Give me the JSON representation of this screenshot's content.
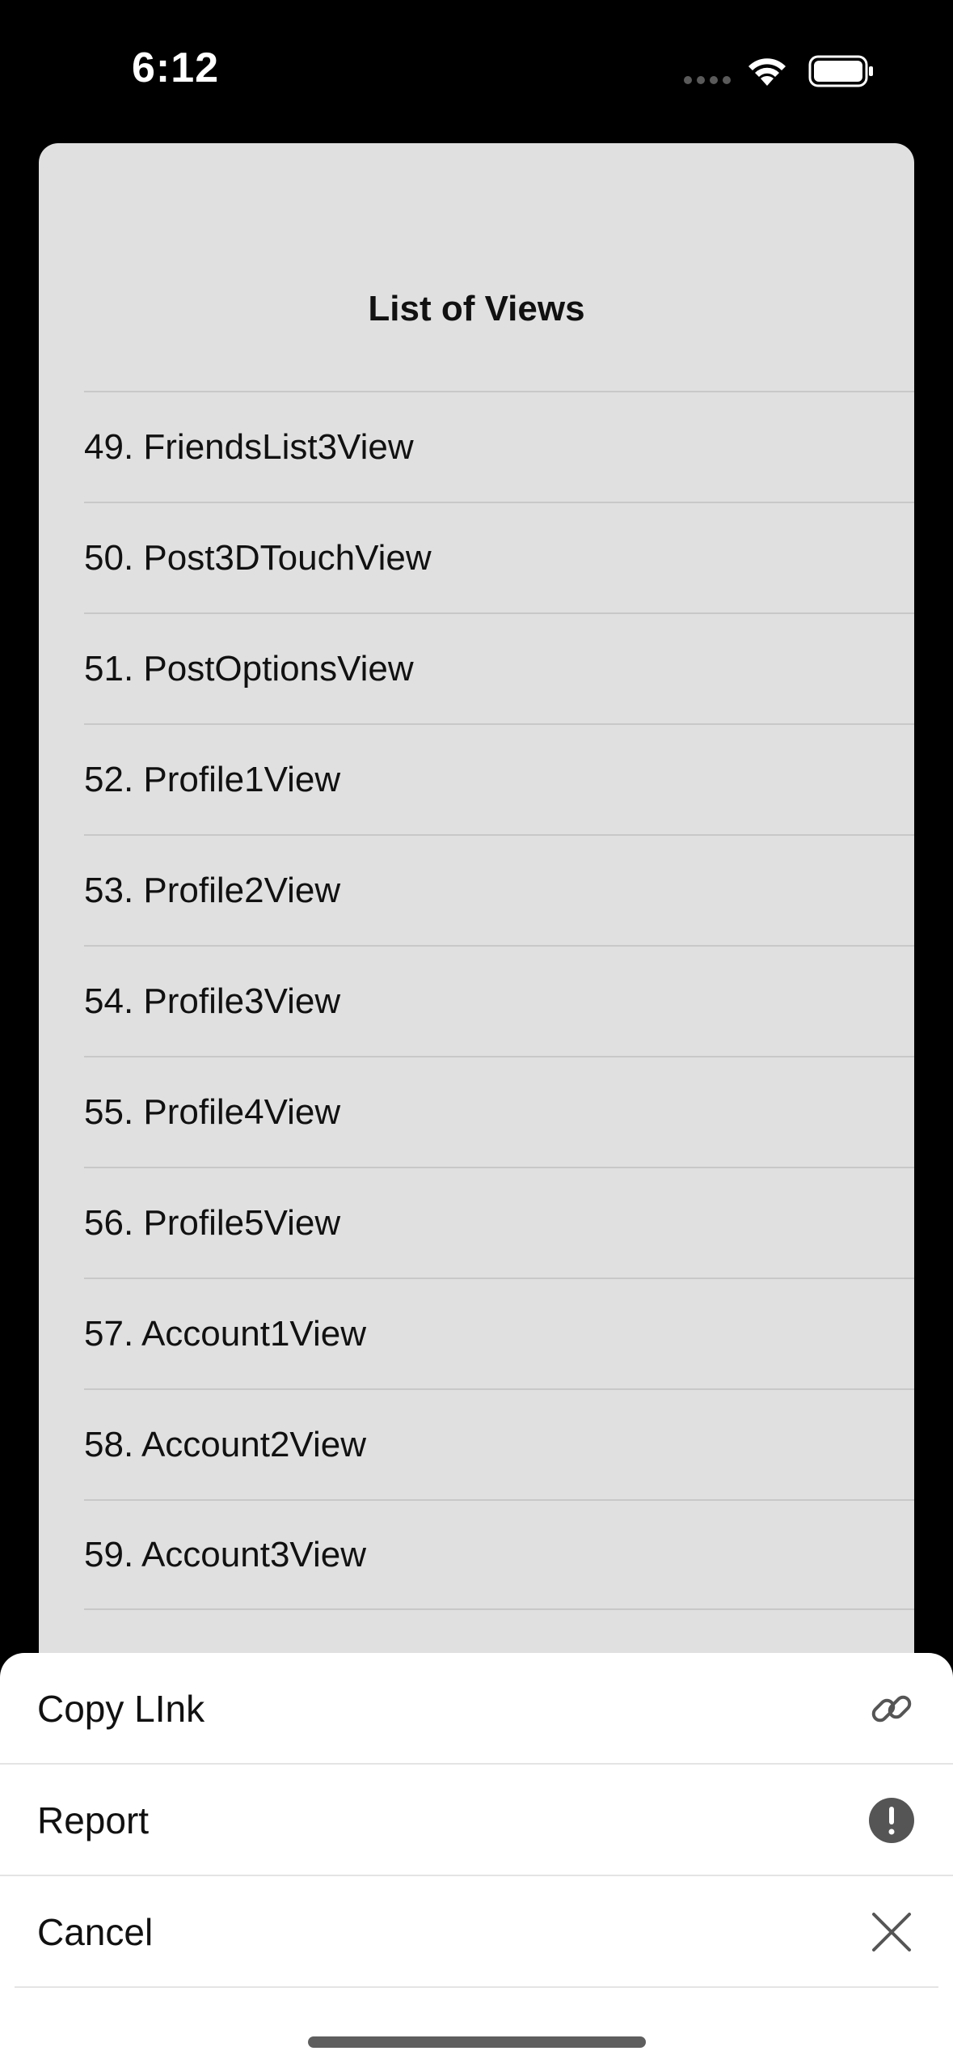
{
  "status_bar": {
    "time": "6:12",
    "icons": [
      "signal-dots-icon",
      "wifi-icon",
      "battery-icon"
    ]
  },
  "card": {
    "title": "List of Views",
    "items": [
      "49. FriendsList3View",
      "50. Post3DTouchView",
      "51. PostOptionsView",
      "52. Profile1View",
      "53. Profile2View",
      "54. Profile3View",
      "55. Profile4View",
      "56. Profile5View",
      "57. Account1View",
      "58. Account2View",
      "59. Account3View"
    ]
  },
  "action_sheet": {
    "actions": [
      {
        "label": "Copy LInk",
        "icon": "link-icon"
      },
      {
        "label": "Report",
        "icon": "exclamation-circle-icon"
      },
      {
        "label": "Cancel",
        "icon": "close-icon"
      }
    ]
  },
  "colors": {
    "background": "#000000",
    "card": "#e0e0e0",
    "sheet": "#ffffff",
    "icon": "#555555"
  }
}
